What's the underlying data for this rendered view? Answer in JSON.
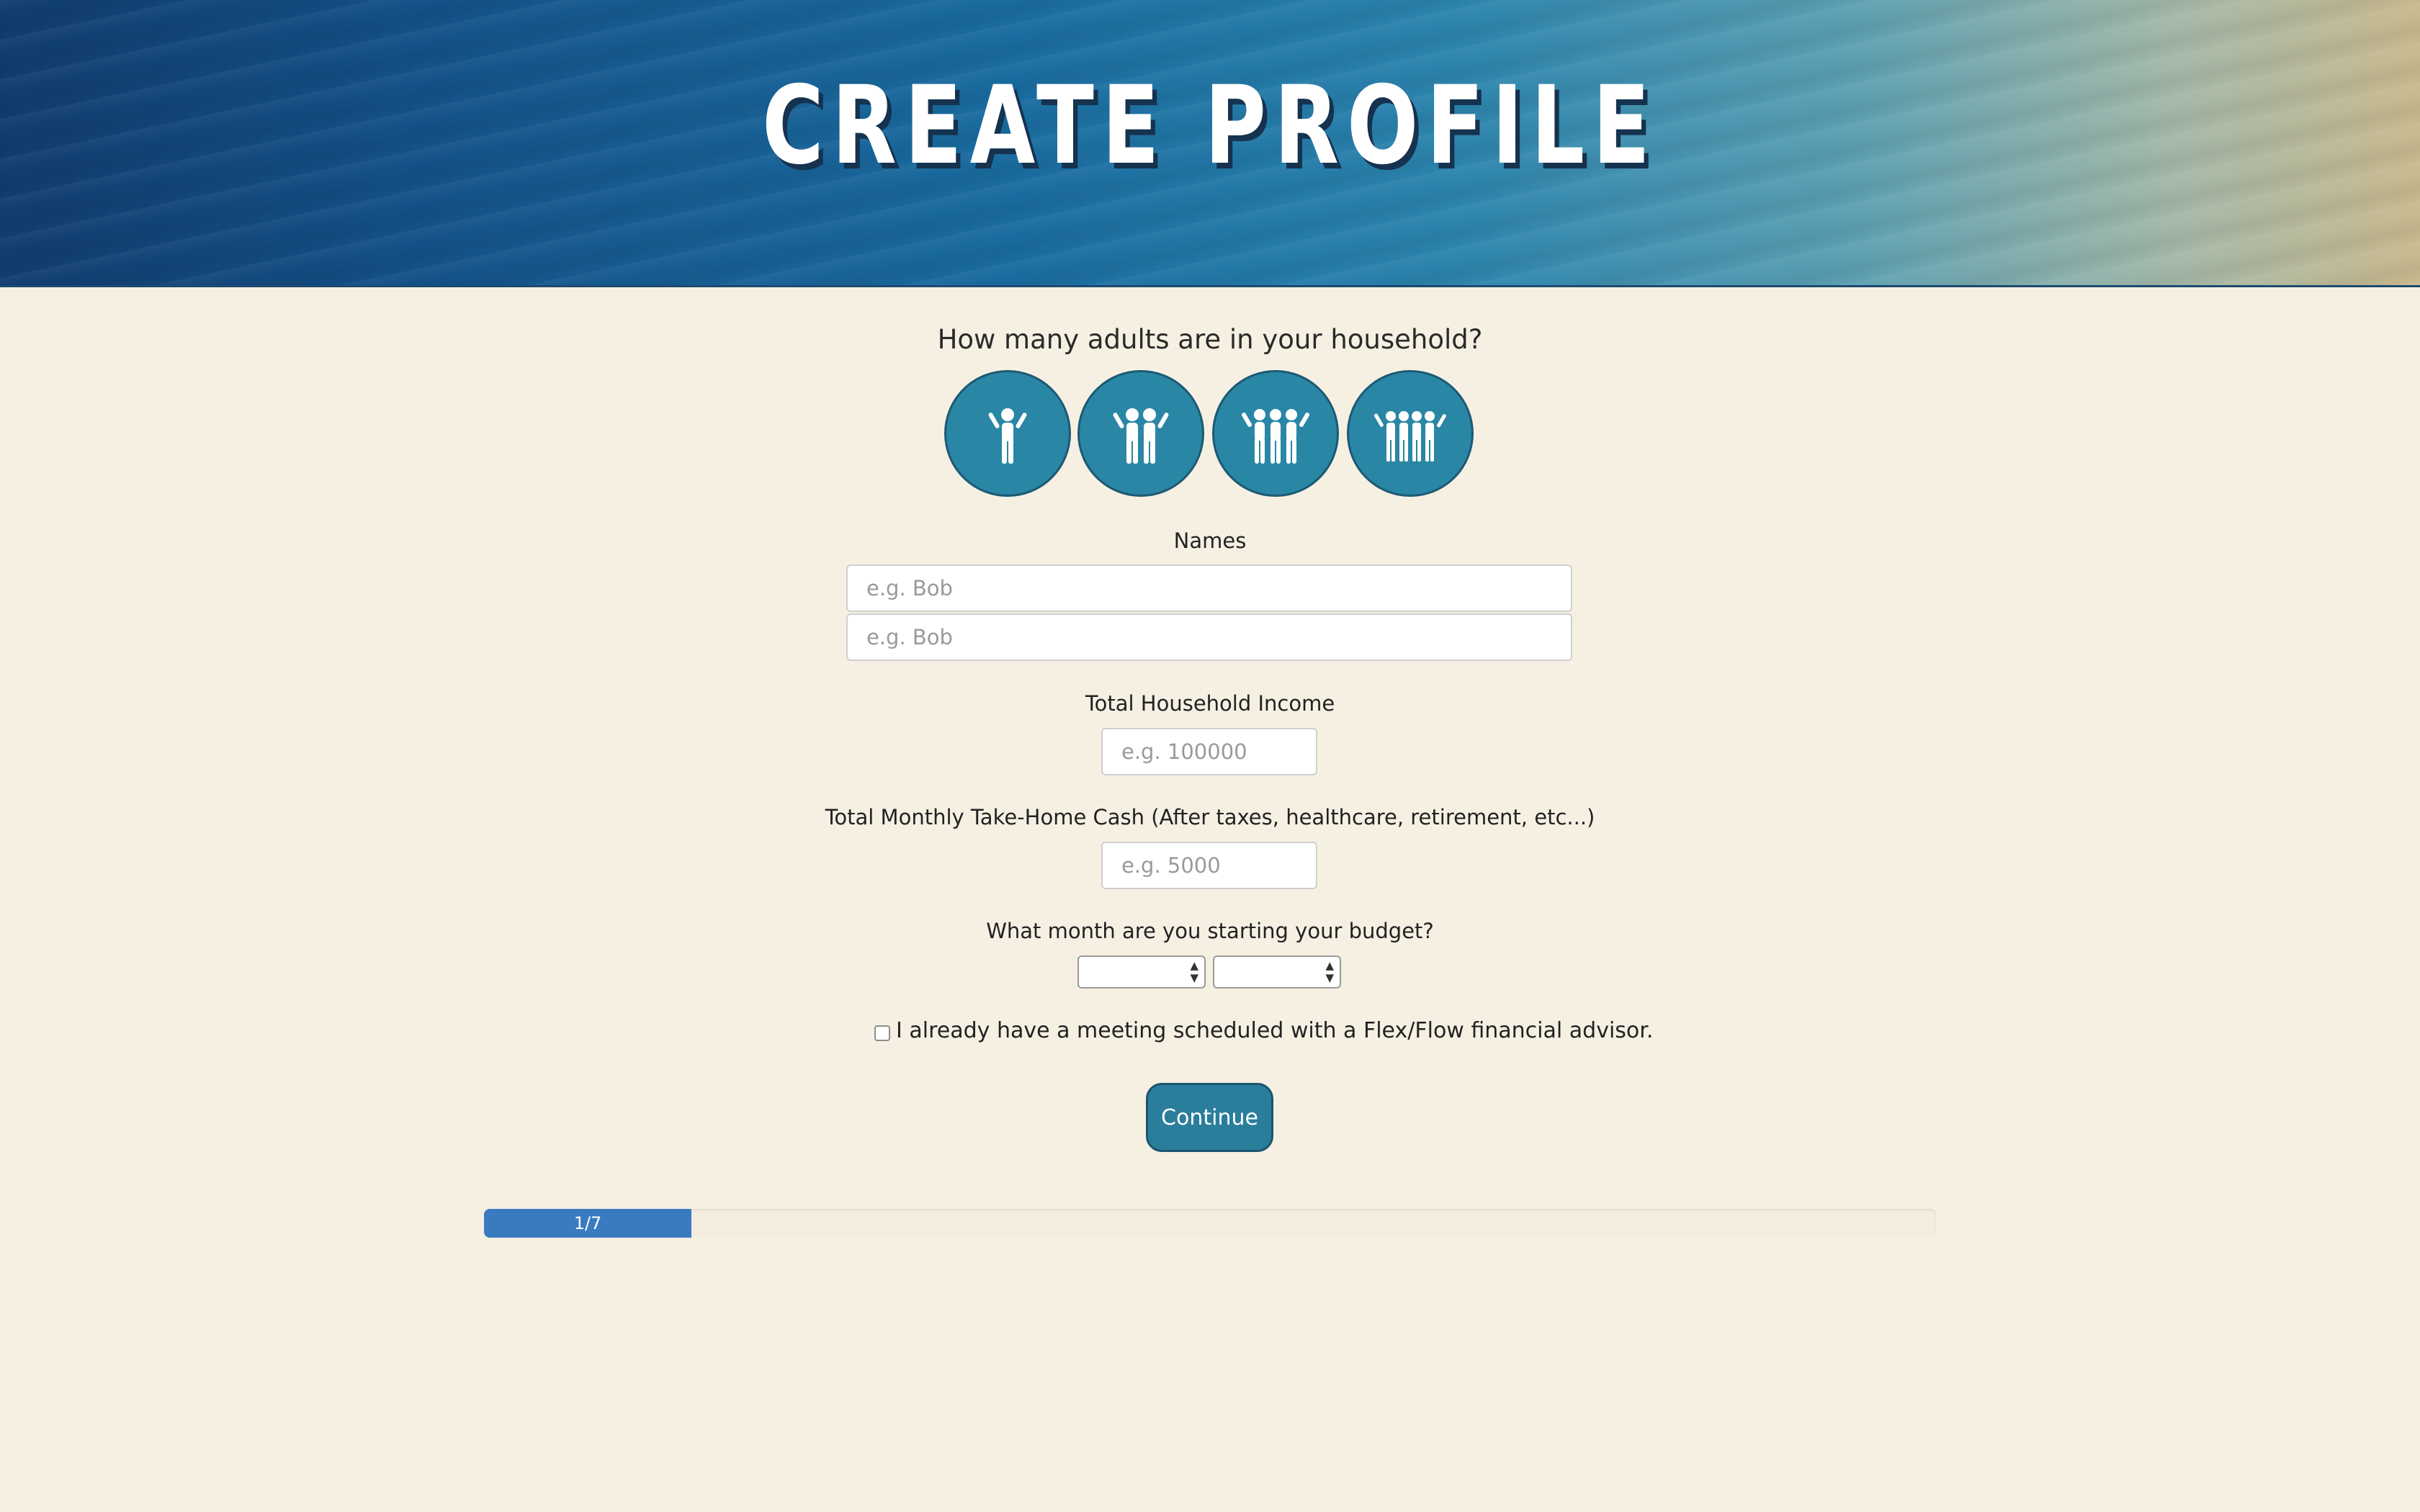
{
  "header": {
    "title": "CREATE PROFILE"
  },
  "household": {
    "question": "How many adults are in your household?",
    "options": [
      {
        "icon": "one-adult-icon",
        "count": 1
      },
      {
        "icon": "two-adults-icon",
        "count": 2
      },
      {
        "icon": "three-adults-icon",
        "count": 3
      },
      {
        "icon": "four-adults-icon",
        "count": 4
      }
    ]
  },
  "names": {
    "label": "Names",
    "fields": [
      {
        "placeholder": "e.g. Bob",
        "value": ""
      },
      {
        "placeholder": "e.g. Bob",
        "value": ""
      }
    ]
  },
  "income": {
    "label": "Total Household Income",
    "placeholder": "e.g. 100000",
    "value": ""
  },
  "take_home": {
    "label": "Total Monthly Take-Home Cash (After taxes, healthcare, retirement, etc...)",
    "placeholder": "e.g. 5000",
    "value": ""
  },
  "budget_start": {
    "label": "What month are you starting your budget?",
    "month_selected": "",
    "year_selected": ""
  },
  "advisor": {
    "checked": false,
    "label": "I already have a meeting scheduled with a Flex/Flow financial advisor."
  },
  "actions": {
    "continue_label": "Continue"
  },
  "progress": {
    "label": "1/7",
    "fraction": 0.142857
  },
  "colors": {
    "background": "#f6f0e3",
    "accent": "#2a86a5",
    "progress": "#3a7bc0"
  }
}
